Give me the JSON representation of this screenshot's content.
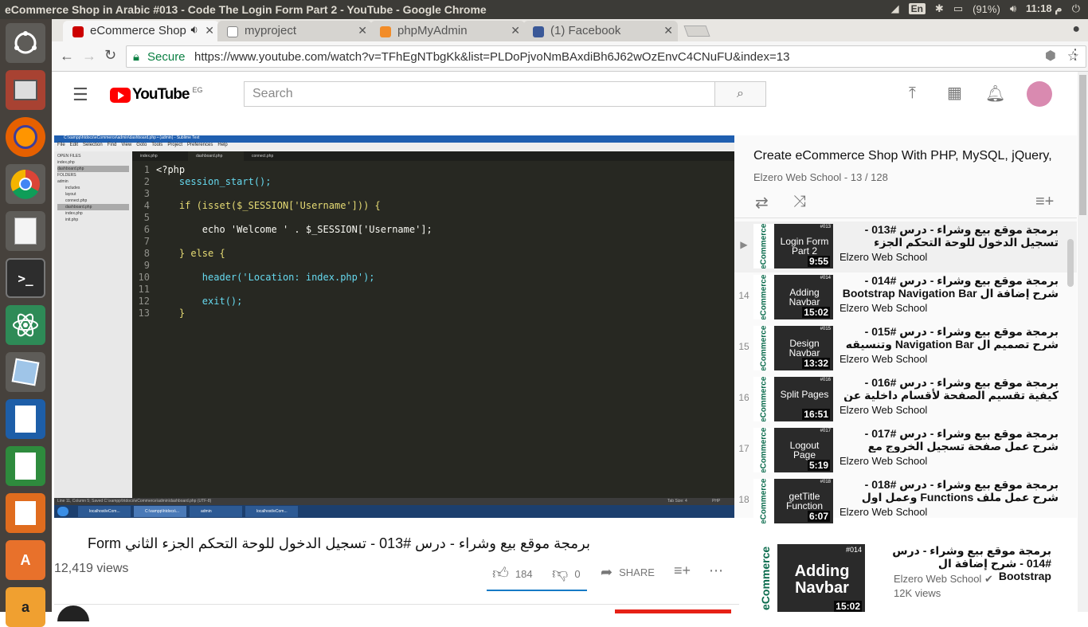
{
  "os": {
    "window_title": "eCommerce Shop in Arabic #013 - Code The Login Form Part 2 - YouTube - Google Chrome",
    "lang": "En",
    "battery": "(91%)",
    "clock": "11:18 م"
  },
  "tabs": [
    {
      "label": "eCommerce Shop",
      "fav": "#cc0000",
      "active": true
    },
    {
      "label": "myproject",
      "fav": "#888888",
      "active": false
    },
    {
      "label": "phpMyAdmin",
      "fav": "#f28c28",
      "active": false
    },
    {
      "label": "(1) Facebook",
      "fav": "#3b5998",
      "active": false
    }
  ],
  "address": {
    "secure_label": "Secure",
    "url": "https://www.youtube.com/watch?v=TFhEgNTbgKk&list=PLDoPjvoNmBAxdiBh6J62wOzEnvC4CNuFU&index=13"
  },
  "youtube": {
    "logo": "YouTube",
    "region": "EG",
    "search_placeholder": "Search"
  },
  "editor": {
    "window_title": "C:\\xampp\\htdocs\\eCommerce\\admin\\dashboard.php • (admin) - Sublime Text",
    "menu": [
      "File",
      "Edit",
      "Selection",
      "Find",
      "View",
      "Goto",
      "Tools",
      "Project",
      "Preferences",
      "Help"
    ],
    "tabs": [
      "index.php",
      "dashboard.php",
      "connect.php"
    ],
    "sidebar": [
      "OPEN FILES",
      "index.php",
      "dashboard.php",
      "FOLDERS",
      "admin",
      "includes",
      "layout",
      "connect.php",
      "dashboard.php",
      "index.php",
      "init.php"
    ],
    "lines": [
      "<?php",
      "    session_start();",
      "",
      "    if (isset($_SESSION['Username'])) {",
      "",
      "        echo 'Welcome ' . $_SESSION['Username'];",
      "",
      "    } else {",
      "",
      "        header('Location: index.php');",
      "",
      "        exit();",
      "    }"
    ],
    "status": "Line 11, Column 5; Saved C:\\xampp\\htdocs\\eCommerce\\admin\\dashboard.php (UTF-8)",
    "status_right": "Tab Size: 4",
    "status_lang": "PHP",
    "taskbar": [
      "localhost/eCom...",
      "C:\\xampp\\htdocs\\...",
      "admin",
      "localhost/eCom..."
    ]
  },
  "playlist": {
    "title": "Create eCommerce Shop With PHP, MySQL, jQuery,",
    "meta": "Elzero Web School - 13 / 128",
    "items": [
      {
        "num": "▶",
        "thumb": "Login Form Part 2",
        "tag": "#013",
        "dur": "9:55",
        "title": "برمجة موقع بيع وشراء - درس #013 - تسجيل الدخول للوحة التحكم الجزء الثاني Form",
        "channel": "Elzero Web School"
      },
      {
        "num": "14",
        "thumb": "Adding Navbar",
        "tag": "#014",
        "dur": "15:02",
        "title": "برمجة موقع بيع وشراء - درس #014 - شرح إضافة ال Bootstrap Navigation Bar للمشروع",
        "channel": "Elzero Web School"
      },
      {
        "num": "15",
        "thumb": "Design Navbar",
        "tag": "#015",
        "dur": "13:32",
        "title": "برمجة موقع بيع وشراء - درس #015 - شرح تصميم ال Navigation Bar وتنسيقه",
        "channel": "Elzero Web School"
      },
      {
        "num": "16",
        "thumb": "Split Pages",
        "tag": "#016",
        "dur": "16:51",
        "title": "برمجة موقع بيع وشراء - درس #016 - كيفية تقسيم الصفحة لأقسام داخلية عن طريق Get",
        "channel": "Elzero Web School"
      },
      {
        "num": "17",
        "thumb": "Logout Page",
        "tag": "#017",
        "dur": "5:19",
        "title": "برمجة موقع بيع وشراء - درس #017 - شرح عمل صفحة تسجيل الخروج مع Logout.php",
        "channel": "Elzero Web School"
      },
      {
        "num": "18",
        "thumb": "getTitle Function",
        "tag": "#018",
        "dur": "6:07",
        "title": "برمجة موقع بيع وشراء - درس #018 - شرح عمل ملف Functions وعمل اول Function",
        "channel": "Elzero Web School"
      }
    ]
  },
  "video": {
    "title": "برمجة موقع بيع وشراء - درس #013 - تسجيل الدخول للوحة التحكم الجزء الثاني Form",
    "views": "12,419 views",
    "likes": "184",
    "dislikes": "0",
    "share": "SHARE"
  },
  "upnext": {
    "thumb": "Adding Navbar",
    "tag": "#014",
    "dur": "15:02",
    "title": "برمجة موقع بيع وشراء - درس #014 - شرح إضافة ال Bootstrap",
    "channel": "Elzero Web School",
    "views": "12K views"
  }
}
